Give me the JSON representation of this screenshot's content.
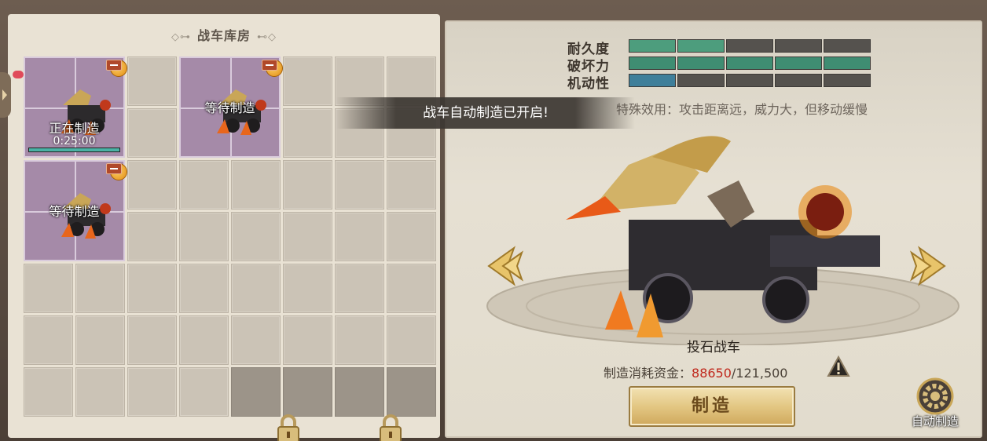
{
  "storage": {
    "title": "战车库房",
    "slots": [
      {
        "status": "正在制造",
        "timer": "0:25:00",
        "progress": 1.0
      },
      {
        "status": "等待制造"
      },
      {
        "status": "等待制造"
      }
    ]
  },
  "details": {
    "stats": [
      {
        "label": "耐久度",
        "filled": 2,
        "total": 5,
        "color": "#4d9d7d"
      },
      {
        "label": "破坏力",
        "filled": 5,
        "total": 5,
        "color": "#3f8d72"
      },
      {
        "label": "机动性",
        "filled": 1,
        "total": 5,
        "color": "#3f7f9a"
      }
    ],
    "effect": "特殊效用：攻击距离远，威力大，但移动缓慢",
    "chariot_name": "投石战车",
    "cost_label": "制造消耗资金：",
    "cost_current": "88650",
    "cost_total": "/121,500",
    "build_label": "制造",
    "auto_label": "自动制造"
  },
  "toast": "战车自动制造已开启!",
  "colors": {
    "slot_bg": "#a58aa8",
    "cost_red": "#c0281c",
    "progress": "#4ab2a5"
  }
}
